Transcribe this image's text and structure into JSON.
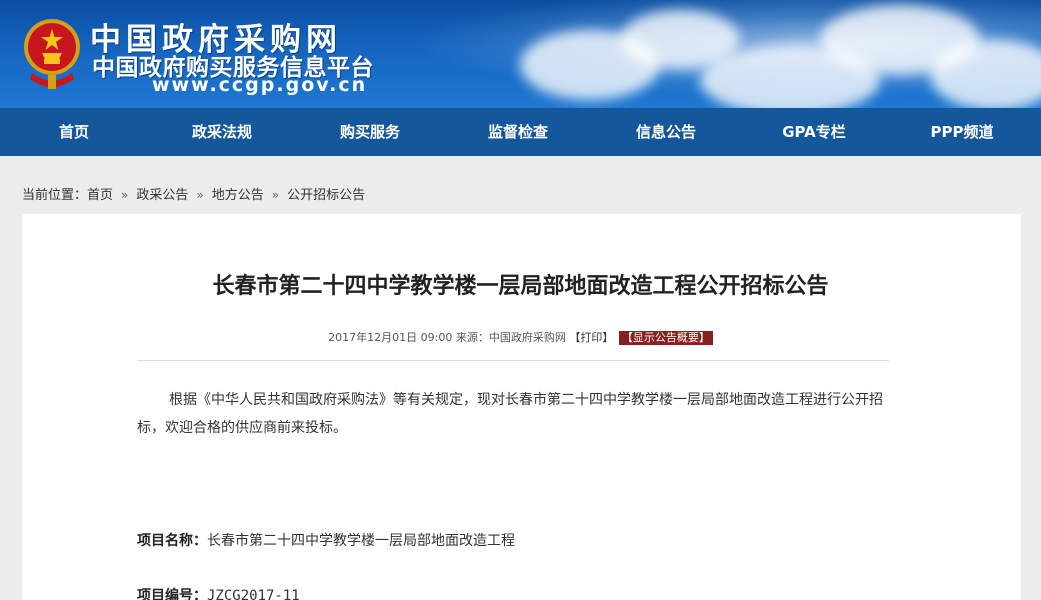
{
  "header": {
    "title": "中国政府采购网",
    "subtitle": "中国政府购买服务信息平台",
    "url": "www.ccgp.gov.cn"
  },
  "nav": {
    "items": [
      {
        "label": "首页"
      },
      {
        "label": "政采法规"
      },
      {
        "label": "购买服务"
      },
      {
        "label": "监督检查"
      },
      {
        "label": "信息公告"
      },
      {
        "label": "GPA专栏"
      },
      {
        "label": "PPP频道"
      }
    ]
  },
  "breadcrumb": {
    "prefix": "当前位置：",
    "items": [
      "首页",
      "政采公告",
      "地方公告",
      "公开招标公告"
    ],
    "separator": "»"
  },
  "article": {
    "title": "长春市第二十四中学教学楼一层局部地面改造工程公开招标公告",
    "date": "2017年12月01日 09:00",
    "source_label": "来源：",
    "source": "中国政府采购网",
    "print_label": "【打印】",
    "summary_label": "【显示公告概要】",
    "intro": "根据《中华人民共和国政府采购法》等有关规定，现对长春市第二十四中学教学楼一层局部地面改造工程进行公开招标，欢迎合格的供应商前来投标。",
    "project_name_label": "项目名称：",
    "project_name": "长春市第二十四中学教学楼一层局部地面改造工程",
    "project_no_label": "项目编号：",
    "project_no": "JZCG2017-11"
  },
  "colors": {
    "nav_bg": "#15579b",
    "banner_blue": "#1565c0",
    "summary_badge": "#8b1e1e"
  }
}
